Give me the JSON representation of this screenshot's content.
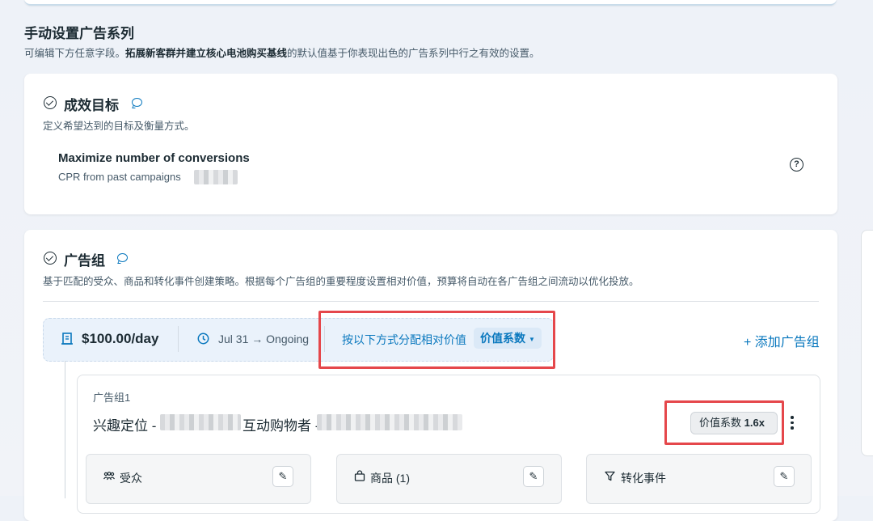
{
  "header": {
    "title": "手动设置广告系列",
    "subtitle_prefix": "可编辑下方任意字段。",
    "subtitle_bold": "拓展新客群并建立核心电池购买基线",
    "subtitle_suffix": "的默认值基于你表现出色的广告系列中行之有效的设置。"
  },
  "goal_section": {
    "title": "成效目标",
    "description": "定义希望达到的目标及衡量方式。",
    "goal_name": "Maximize number of conversions",
    "goal_sub": "CPR from past campaigns",
    "help_icon": "?"
  },
  "adgroup_section": {
    "title": "广告组",
    "description": "基于匹配的受众、商品和转化事件创建策略。根据每个广告组的重要程度设置相对价值，预算将自动在各广告组之间流动以优化投放。",
    "budget": "$100.00/day",
    "schedule": "Jul 31 → Ongoing",
    "allocate_label": "按以下方式分配相对价值",
    "allocate_value": "价值系数",
    "add_group": "+ 添加广告组"
  },
  "adgroup1": {
    "label": "广告组1",
    "name_part1": "兴趣定位 -",
    "name_part2": "互动购物者 -",
    "value_label": "价值系数",
    "value_number": "1.6x",
    "audience_label": "受众",
    "products_label": "商品 (1)",
    "conversion_label": "转化事件"
  },
  "icons": {
    "budget": "receipt-icon",
    "schedule": "clock-icon",
    "audience": "people-icon",
    "products": "bag-icon",
    "conversion": "filter-icon",
    "edit": "pencil-icon"
  },
  "colors": {
    "accent": "#0a78be",
    "highlight_red": "#e5474b"
  }
}
